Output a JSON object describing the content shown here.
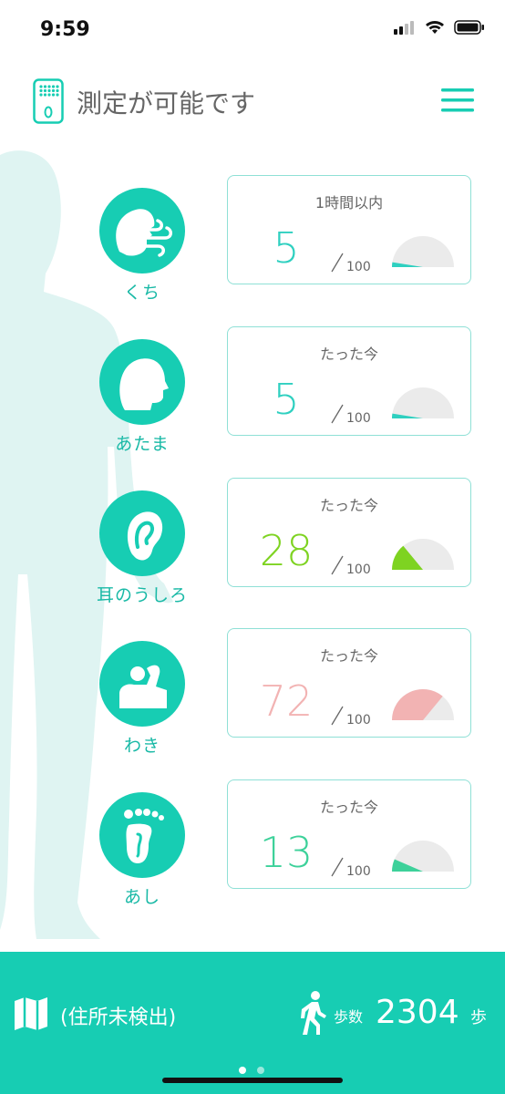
{
  "status_bar": {
    "time": "9:59"
  },
  "header": {
    "title": "測定が可能です"
  },
  "colors": {
    "accent": "#17cdb3",
    "gauge_track": "#ebebeb"
  },
  "readings": [
    {
      "part": "くち",
      "icon": "mouth-breath-icon",
      "time": "1時間以内",
      "value": "5",
      "max": "100",
      "level": 0.05,
      "color": "#2fd0c0"
    },
    {
      "part": "あたま",
      "icon": "head-icon",
      "time": "たった今",
      "value": "5",
      "max": "100",
      "level": 0.05,
      "color": "#2fd0c0"
    },
    {
      "part": "耳のうしろ",
      "icon": "ear-icon",
      "time": "たった今",
      "value": "28",
      "max": "100",
      "level": 0.28,
      "color": "#7ed321"
    },
    {
      "part": "わき",
      "icon": "armpit-icon",
      "time": "たった今",
      "value": "72",
      "max": "100",
      "level": 0.72,
      "color": "#f2b3b3"
    },
    {
      "part": "あし",
      "icon": "foot-icon",
      "time": "たった今",
      "value": "13",
      "max": "100",
      "level": 0.13,
      "color": "#3dd19a"
    }
  ],
  "footer": {
    "address": "(住所未検出)",
    "steps_label": "歩数",
    "steps_value": "2304",
    "steps_unit": "歩",
    "page_count": 2,
    "active_page": 1
  }
}
